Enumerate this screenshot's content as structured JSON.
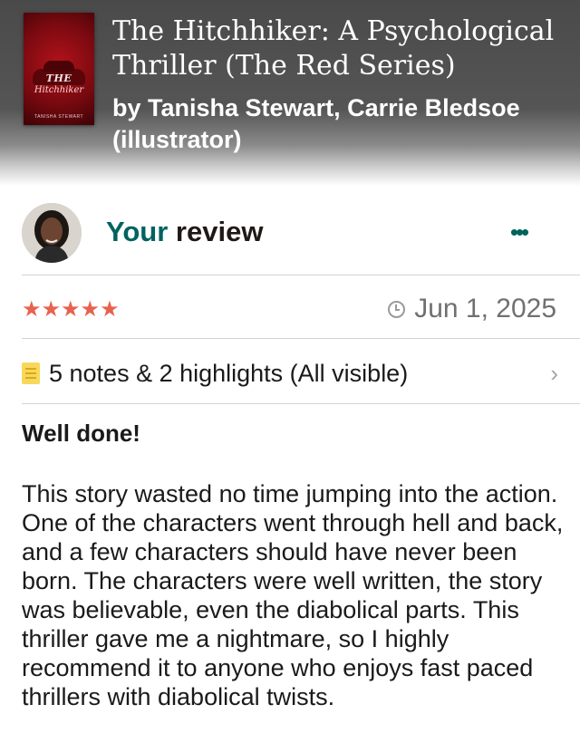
{
  "book": {
    "title": "The Hitchhiker: A Psychological Thriller (The Red Series)",
    "author_line": "by Tanisha Stewart, Carrie Bledsoe (illustrator)",
    "cover": {
      "text_the": "THE",
      "text_title": "Hitchhiker",
      "text_author": "TANISHA STEWART"
    }
  },
  "review": {
    "heading_highlight": "Your",
    "heading_rest": " review",
    "more_label": "•••",
    "rating_stars": "★★★★★",
    "rating": 5,
    "date": "Jun 1, 2025",
    "notes_summary": "5 notes & 2 highlights (All visible)",
    "chevron": "›",
    "title": "Well done!",
    "body": "This story wasted no time jumping into the action. One of the characters went through hell and back, and a few characters should have never been born. The characters were well written, the story was believable, even the diabolical parts. This thriller gave me a nightmare, so I highly recommend it to anyone who enjoys fast paced thrillers with diabolical twists."
  },
  "colors": {
    "accent": "#00635d",
    "stars": "#e8624f",
    "note_icon": "#f8d85a"
  },
  "icons": {
    "clock": "clock-icon",
    "notes": "notes-icon",
    "more": "more-options-icon",
    "chevron": "chevron-right-icon"
  }
}
